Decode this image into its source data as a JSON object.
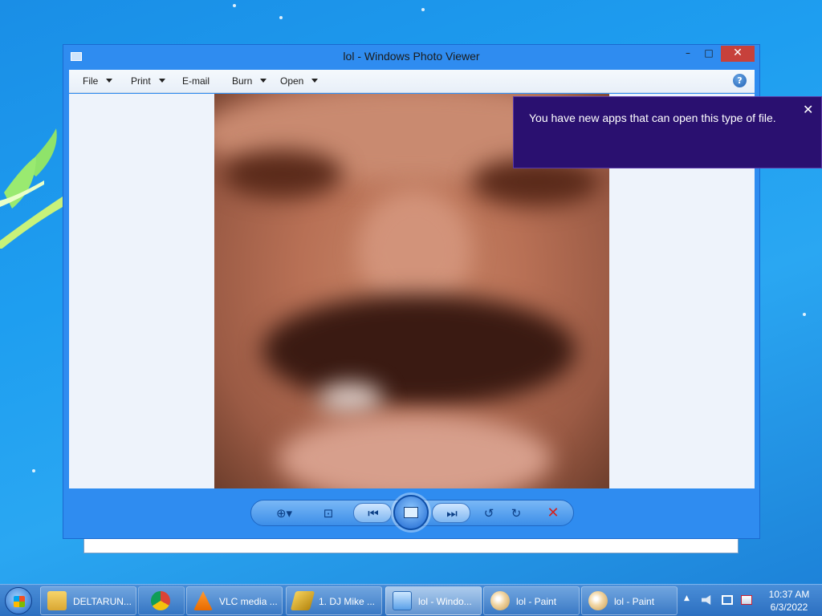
{
  "window": {
    "title": "lol - Windows Photo Viewer",
    "controls": {
      "minimize": "–",
      "maximize": "□",
      "close": "✕"
    }
  },
  "menu": {
    "file": "File",
    "print": "Print",
    "email": "E-mail",
    "burn": "Burn",
    "open": "Open",
    "help": "?"
  },
  "viewer": {
    "image_description_icon": "photo",
    "toolbar_icons": [
      "zoom-icon",
      "fit-to-window-icon",
      "previous-icon",
      "slideshow-icon",
      "next-icon",
      "rotate-counterclockwise-icon",
      "rotate-clockwise-icon",
      "delete-icon"
    ]
  },
  "toast": {
    "message": "You have new apps that can open this type of file.",
    "close": "✕"
  },
  "taskbar": {
    "items": [
      {
        "label": "DELTARUN...",
        "icon": "folder-icon"
      },
      {
        "label": "VLC media ...",
        "icon": "vlc-icon"
      },
      {
        "label": "1. DJ Mike ...",
        "icon": "winamp-icon"
      },
      {
        "label": "lol - Windo...",
        "icon": "photo-viewer-icon",
        "active": true
      },
      {
        "label": "lol - Paint",
        "icon": "paint-icon"
      },
      {
        "label": "lol - Paint",
        "icon": "paint-icon"
      }
    ],
    "pinned": [
      "chrome-icon"
    ],
    "clock": {
      "time": "10:37 AM",
      "date": "6/3/2022"
    },
    "tray": {
      "expand": "▲"
    }
  },
  "colors": {
    "accent": "#2f8cf0",
    "toast_bg": "#2a1070",
    "close_red": "#c7413b"
  }
}
